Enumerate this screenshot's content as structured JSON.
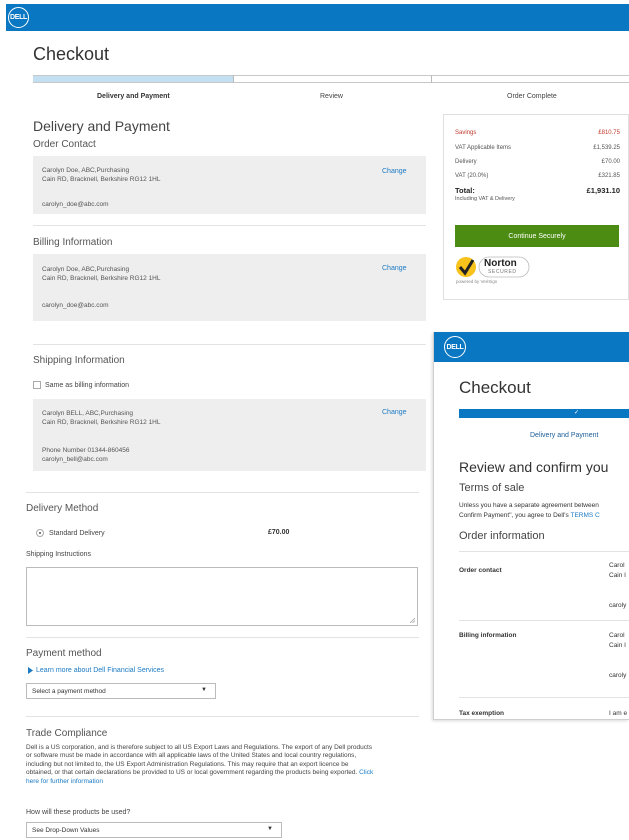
{
  "header": {
    "logo_text": "DELL"
  },
  "page": {
    "title": "Checkout"
  },
  "steps": [
    "Delivery and Payment",
    "Review",
    "Order Complete"
  ],
  "delivery_payment": {
    "title": "Delivery and Payment"
  },
  "order_contact": {
    "title": "Order Contact",
    "line1": "Carolyn Doe,  ABC,Purchasing",
    "line2": "Cain RD, Bracknell, Berkshire RG12 1HL",
    "email": "carolyn_doe@abc.com",
    "change_label": "Change"
  },
  "billing": {
    "title": "Billing Information",
    "line1": "Carolyn Doe,  ABC,Purchasing",
    "line2": "Cain RD, Bracknell, Berkshire RG12 1HL",
    "email": "carolyn_doe@abc.com",
    "change_label": "Change"
  },
  "shipping": {
    "title": "Shipping Information",
    "same_as_billing_label": "Same as billing information",
    "line1": "Carolyn BELL,  ABC,Purchasing",
    "line2": "Cain RD, Bracknell, Berkshire RG12 1HL",
    "phone": "Phone Number 01344-860456",
    "email": "carolyn_bell@abc.com",
    "change_label": "Change"
  },
  "delivery_method": {
    "title": "Delivery Method",
    "option_label": "Standard Delivery",
    "option_price": "£70.00",
    "instructions_label": "Shipping Instructions"
  },
  "payment": {
    "title": "Payment method",
    "learn_more": "Learn more about Dell Financial Services",
    "select_value": "Select a payment method"
  },
  "trade": {
    "title": "Trade Compliance",
    "lines": [
      "Dell is a US corporation, and is therefore subject to all US Export Laws and Regulations. The export of any Dell products",
      "or software must be made in accordance with all applicable laws of the United States and local country regulations,",
      "including but not limited to, the US Export Administration Regulations. This may require that an export licence be",
      "obtained, or that certain declarations be provided to US or local government regarding the products being exported."
    ],
    "link_part1": "Click",
    "link_part2": "here for further information",
    "question": "How will these products be used?",
    "select_value": "See Drop-Down Values"
  },
  "summary": {
    "savings_label": "Savings",
    "savings_value": "£810.75",
    "vat_items_label": "VAT Applicable Items",
    "vat_items_value": "£1,539.25",
    "delivery_label": "Delivery",
    "delivery_value": "£70.00",
    "vat_label": "VAT (20.0%)",
    "vat_value": "£321.85",
    "total_label": "Total:",
    "total_value": "£1,931.10",
    "total_note": "Including VAT & Delivery",
    "continue_label": "Continue Securely",
    "norton_name": "Norton",
    "norton_secured": "SECURED",
    "norton_powered": "powered by VeriSign"
  },
  "review": {
    "logo_text": "DELL",
    "title": "Checkout",
    "progress_check": "✓",
    "step_label": "Delivery and Payment",
    "heading": "Review and confirm you",
    "terms_title": "Terms of sale",
    "terms_line1": "Unless you have a separate agreement between",
    "terms_line2_a": "Confirm Payment\", you agree to Dell's",
    "terms_line2_link": "TERMS C",
    "order_info_title": "Order information",
    "order_contact_label": "Order contact",
    "oc_name": "Carol",
    "oc_addr": "Cain I",
    "oc_email": "caroly",
    "billing_label": "Billing information",
    "b_name": "Carol",
    "b_addr": "Cain I",
    "b_email": "caroly",
    "tax_label": "Tax exemption",
    "tax_value": "I am e"
  },
  "colors": {
    "brand_blue": "#0a77c2",
    "continue_green": "#4c8c12",
    "savings_red": "#c0392b",
    "link_blue": "#1b7ac4"
  }
}
